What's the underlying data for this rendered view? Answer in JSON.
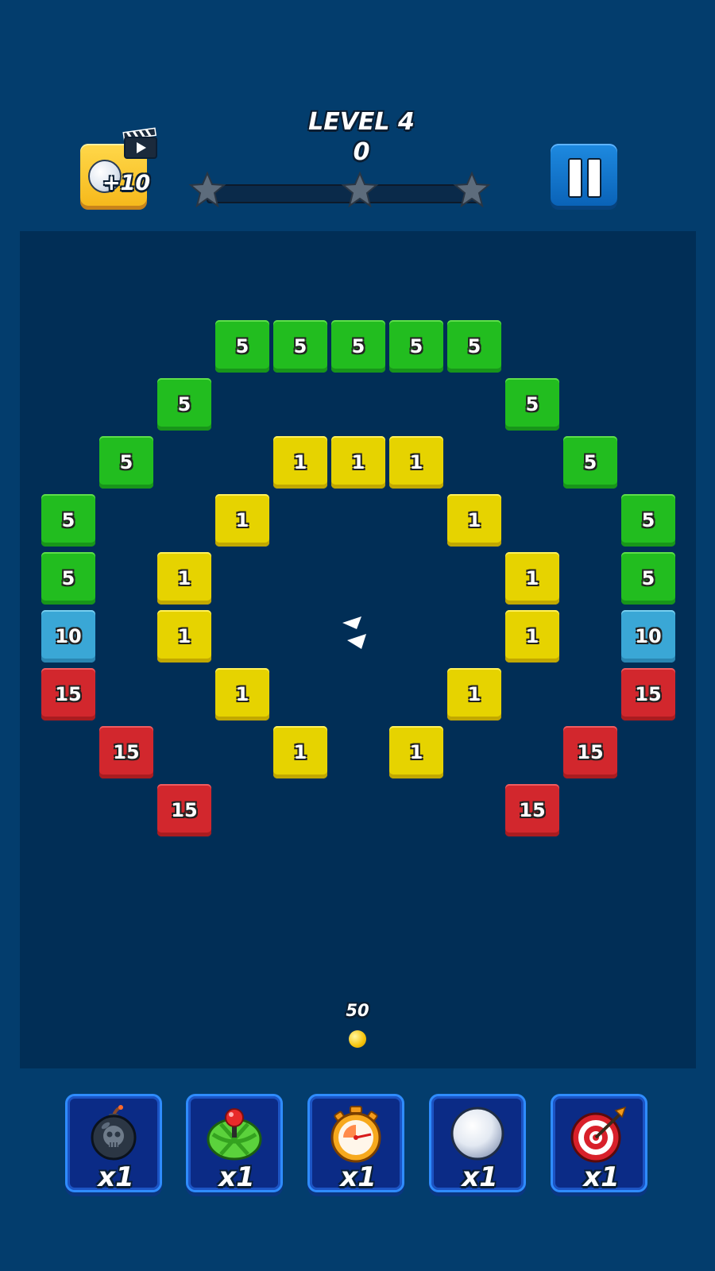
{
  "header": {
    "level_title": "LEVEL 4",
    "score": "0",
    "ad_bonus_label": "+10",
    "progress_fraction": 0,
    "stars_earned": 0
  },
  "colors": {
    "background": "#033d6d",
    "board": "#012e56",
    "green_brick": "#22bd1f",
    "yellow_brick": "#e6d300",
    "blue_brick": "#3aa7d6",
    "red_brick": "#d2272d"
  },
  "bricks": [
    {
      "col": 3,
      "row": 0,
      "color": "green",
      "value": "5"
    },
    {
      "col": 4,
      "row": 0,
      "color": "green",
      "value": "5"
    },
    {
      "col": 5,
      "row": 0,
      "color": "green",
      "value": "5"
    },
    {
      "col": 6,
      "row": 0,
      "color": "green",
      "value": "5"
    },
    {
      "col": 7,
      "row": 0,
      "color": "green",
      "value": "5"
    },
    {
      "col": 2,
      "row": 1,
      "color": "green",
      "value": "5"
    },
    {
      "col": 8,
      "row": 1,
      "color": "green",
      "value": "5"
    },
    {
      "col": 1,
      "row": 2,
      "color": "green",
      "value": "5"
    },
    {
      "col": 4,
      "row": 2,
      "color": "yellow",
      "value": "1"
    },
    {
      "col": 5,
      "row": 2,
      "color": "yellow",
      "value": "1"
    },
    {
      "col": 6,
      "row": 2,
      "color": "yellow",
      "value": "1"
    },
    {
      "col": 9,
      "row": 2,
      "color": "green",
      "value": "5"
    },
    {
      "col": 0,
      "row": 3,
      "color": "green",
      "value": "5"
    },
    {
      "col": 3,
      "row": 3,
      "color": "yellow",
      "value": "1"
    },
    {
      "col": 7,
      "row": 3,
      "color": "yellow",
      "value": "1"
    },
    {
      "col": 10,
      "row": 3,
      "color": "green",
      "value": "5"
    },
    {
      "col": 0,
      "row": 4,
      "color": "green",
      "value": "5"
    },
    {
      "col": 2,
      "row": 4,
      "color": "yellow",
      "value": "1"
    },
    {
      "col": 8,
      "row": 4,
      "color": "yellow",
      "value": "1"
    },
    {
      "col": 10,
      "row": 4,
      "color": "green",
      "value": "5"
    },
    {
      "col": 0,
      "row": 5,
      "color": "blue",
      "value": "10"
    },
    {
      "col": 2,
      "row": 5,
      "color": "yellow",
      "value": "1"
    },
    {
      "col": 8,
      "row": 5,
      "color": "yellow",
      "value": "1"
    },
    {
      "col": 10,
      "row": 5,
      "color": "blue",
      "value": "10"
    },
    {
      "col": 0,
      "row": 6,
      "color": "red",
      "value": "15"
    },
    {
      "col": 3,
      "row": 6,
      "color": "yellow",
      "value": "1"
    },
    {
      "col": 7,
      "row": 6,
      "color": "yellow",
      "value": "1"
    },
    {
      "col": 10,
      "row": 6,
      "color": "red",
      "value": "15"
    },
    {
      "col": 1,
      "row": 7,
      "color": "red",
      "value": "15"
    },
    {
      "col": 4,
      "row": 7,
      "color": "yellow",
      "value": "1"
    },
    {
      "col": 6,
      "row": 7,
      "color": "yellow",
      "value": "1"
    },
    {
      "col": 9,
      "row": 7,
      "color": "red",
      "value": "15"
    },
    {
      "col": 2,
      "row": 8,
      "color": "red",
      "value": "15"
    },
    {
      "col": 8,
      "row": 8,
      "color": "red",
      "value": "15"
    }
  ],
  "launcher": {
    "ball_count": "50"
  },
  "powerups": [
    {
      "icon": "bomb-icon",
      "count": "x1"
    },
    {
      "icon": "joystick-icon",
      "count": "x1"
    },
    {
      "icon": "stopwatch-icon",
      "count": "x1"
    },
    {
      "icon": "extra-ball-icon",
      "count": "x1"
    },
    {
      "icon": "target-icon",
      "count": "x1"
    }
  ]
}
